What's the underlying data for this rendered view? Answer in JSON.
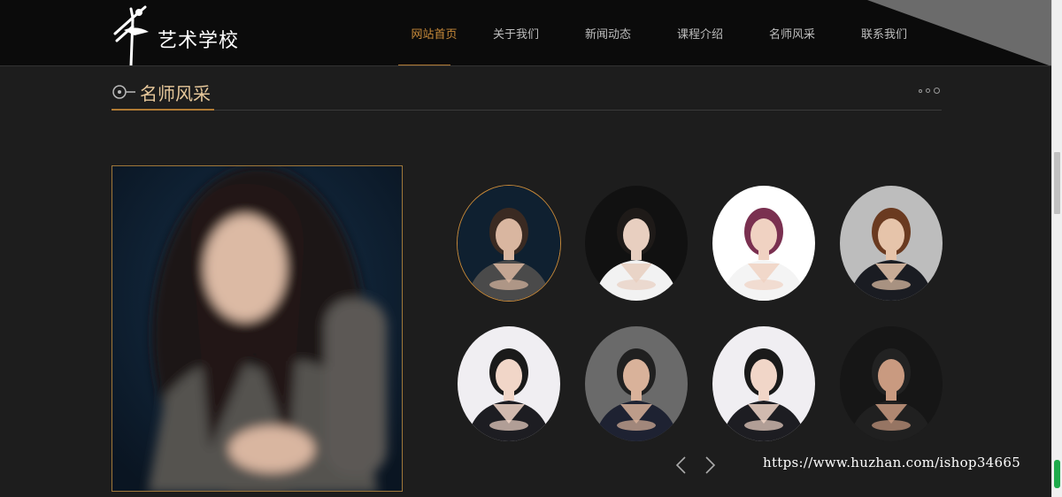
{
  "brand": {
    "name": "艺术学校",
    "logo_icon": "ballerina-logo-icon"
  },
  "nav": {
    "items": [
      {
        "label": "网站首页",
        "active": true
      },
      {
        "label": "关于我们",
        "active": false
      },
      {
        "label": "新闻动态",
        "active": false
      },
      {
        "label": "课程介绍",
        "active": false
      },
      {
        "label": "名师风采",
        "active": false
      },
      {
        "label": "联系我们",
        "active": false
      }
    ]
  },
  "section": {
    "title": "名师风采"
  },
  "teachers": {
    "selected_index": 0,
    "thumbnails": [
      {
        "name": "teacher-1",
        "bg": "#0f2030",
        "top": "#3a2a22",
        "suit": "#4a4a4a",
        "skin": "#d9b6a0"
      },
      {
        "name": "teacher-2",
        "bg": "#111111",
        "top": "#1e1a18",
        "suit": "#f2f2f2",
        "skin": "#e8cfc0"
      },
      {
        "name": "teacher-3",
        "bg": "#ffffff",
        "top": "#7a3050",
        "suit": "#f4f4f4",
        "skin": "#f0d2c2"
      },
      {
        "name": "teacher-4",
        "bg": "#bdbdbd",
        "top": "#6a3a20",
        "suit": "#1a1c22",
        "skin": "#e6c4aa"
      },
      {
        "name": "teacher-5",
        "bg": "#f0eef2",
        "top": "#1a1a1a",
        "suit": "#1d1d22",
        "skin": "#f1d6c8"
      },
      {
        "name": "teacher-6",
        "bg": "#6a6a6a",
        "top": "#202020",
        "suit": "#1e2232",
        "skin": "#d9b29a"
      },
      {
        "name": "teacher-7",
        "bg": "#f0eef2",
        "top": "#1a1a1a",
        "suit": "#1d1d22",
        "skin": "#f1d6c8"
      },
      {
        "name": "teacher-8",
        "bg": "#161616",
        "top": "#222222",
        "suit": "#202020",
        "skin": "#c99a80"
      }
    ]
  },
  "carousel": {
    "prev_icon": "chevron-left-icon",
    "next_icon": "chevron-right-icon"
  },
  "watermark": "https://www.huzhan.com/ishop34665",
  "colors": {
    "accent": "#b07a34",
    "accent_text": "#c88a3a",
    "title": "#e6c79a",
    "background": "#1d1d1d"
  }
}
